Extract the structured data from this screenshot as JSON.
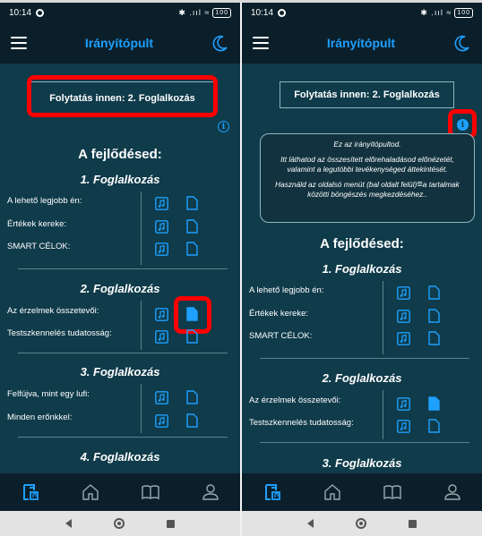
{
  "status_bar": {
    "time": "10:14",
    "signal": "✱ .ııl ≈",
    "battery": "100"
  },
  "app_bar": {
    "title": "Irányítópult"
  },
  "continue_button": "Folytatás innen: 2. Foglalkozás",
  "progress_title": "A fejlődésed:",
  "tooltip": {
    "line1": "Ez az irányítópultod.",
    "line2": "Itt láthatod az összesített előrehaladásod előnézetét, valamint a legutóbbi tevékenységed áttekintését.",
    "line3a": "Használd az oldalsó menüt (bal oldalt felül)",
    "menu_glyph": "≡",
    "line3b": "a tartalmak közötti böngészés megkezdéséhez.."
  },
  "weeks": [
    {
      "title": "1. Foglalkozás",
      "items": [
        "A lehető legjobb én:",
        "Értékek kereke:",
        "SMART CÉLOK:"
      ]
    },
    {
      "title": "2. Foglalkozás",
      "items": [
        "Az érzelmek összetevői:",
        "Testszkennelés tudatosság:"
      ]
    },
    {
      "title": "3. Foglalkozás",
      "items": [
        "Felfújva, mint egy lufi:",
        "Minden erőnkkel:"
      ]
    },
    {
      "title": "4. Foglalkozás",
      "items": []
    }
  ],
  "colors": {
    "accent": "#1ea0ff",
    "background": "#0f3b4a",
    "bar": "#0b1f2a",
    "highlight": "#ff0000"
  },
  "icons": {
    "menu": "hamburger-menu-icon",
    "theme": "moon-icon",
    "info": "info-icon",
    "audio": "music-note-icon",
    "document": "document-icon",
    "nav": [
      "dashboard-icon",
      "home-icon",
      "book-icon",
      "profile-icon"
    ]
  }
}
